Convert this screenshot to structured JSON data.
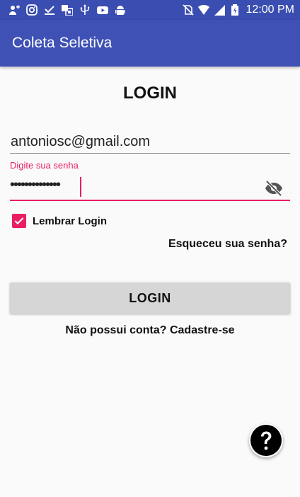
{
  "status_bar": {
    "time": "12:00 PM",
    "left_icons": [
      "add-contact-icon",
      "instagram-icon",
      "download-done-icon",
      "translate-icon",
      "usb-icon",
      "youtube-icon",
      "android-icon"
    ],
    "right_icons": [
      "no-sim-icon",
      "wifi-icon",
      "signal-3g-icon",
      "battery-charging-icon"
    ]
  },
  "app_bar": {
    "title": "Coleta Seletiva"
  },
  "form": {
    "heading": "LOGIN",
    "email_value": "antoniosc@gmail.com",
    "password_label": "Digite sua senha",
    "password_value": "••••••••••••••",
    "remember_label": "Lembrar Login",
    "remember_checked": true,
    "forgot_link": "Esqueceu sua senha?",
    "login_button": "LOGIN",
    "signup_link": "Não possui conta? Cadastre-se"
  },
  "colors": {
    "primary": "#3f51b5",
    "status_bar": "#3a4db0",
    "accent": "#e91e63",
    "button": "#d6d6d6"
  }
}
